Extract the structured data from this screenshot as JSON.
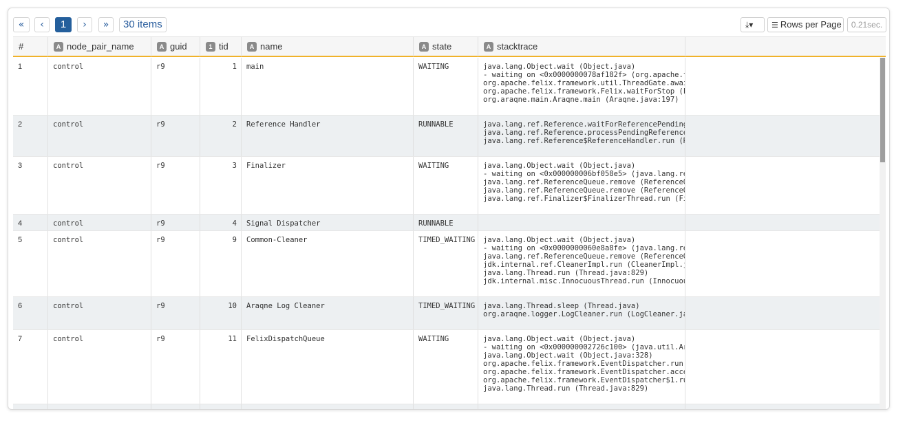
{
  "pagination": {
    "first": "«",
    "prev": "‹",
    "current": "1",
    "next": "›",
    "last": "»",
    "items": "30 items"
  },
  "toolbar": {
    "download_icon": "download-icon",
    "download_glyph": "⤓▾",
    "rows_icon": "list-icon",
    "rows_glyph": "☰",
    "rows_label": "Rows per Page",
    "timing": "0.21sec."
  },
  "columns": [
    {
      "label": "#",
      "badge": ""
    },
    {
      "label": "node_pair_name",
      "badge": "A"
    },
    {
      "label": "guid",
      "badge": "A"
    },
    {
      "label": "tid",
      "badge": "1"
    },
    {
      "label": "name",
      "badge": "A"
    },
    {
      "label": "state",
      "badge": "A"
    },
    {
      "label": "stacktrace",
      "badge": "A"
    }
  ],
  "rows": [
    {
      "n": "1",
      "node": "control",
      "guid": "r9",
      "tid": "1",
      "name": "main",
      "state": "WAITING",
      "stack": "java.lang.Object.wait (Object.java)\n- waiting on <0x0000000078af182f> (org.apache.fel\norg.apache.felix.framework.util.ThreadGate.await\norg.apache.felix.framework.Felix.waitForStop (Fel\norg.araqne.main.Araqne.main (Araqne.java:197)"
    },
    {
      "n": "2",
      "node": "control",
      "guid": "r9",
      "tid": "2",
      "name": "Reference Handler",
      "state": "RUNNABLE",
      "stack": "java.lang.ref.Reference.waitForReferencePendingLi\njava.lang.ref.Reference.processPendingReferences\njava.lang.ref.Reference$ReferenceHandler.run (Ref"
    },
    {
      "n": "3",
      "node": "control",
      "guid": "r9",
      "tid": "3",
      "name": "Finalizer",
      "state": "WAITING",
      "stack": "java.lang.Object.wait (Object.java)\n- waiting on <0x000000006bf058e5> (java.lang.ref.\njava.lang.ref.ReferenceQueue.remove (ReferenceQue\njava.lang.ref.ReferenceQueue.remove (ReferenceQue\njava.lang.ref.Finalizer$FinalizerThread.run (Fina"
    },
    {
      "n": "4",
      "node": "control",
      "guid": "r9",
      "tid": "4",
      "name": "Signal Dispatcher",
      "state": "RUNNABLE",
      "stack": ""
    },
    {
      "n": "5",
      "node": "control",
      "guid": "r9",
      "tid": "9",
      "name": "Common-Cleaner",
      "state": "TIMED_WAITING",
      "stack": "java.lang.Object.wait (Object.java)\n- waiting on <0x0000000060e8a8fe> (java.lang.ref.\njava.lang.ref.ReferenceQueue.remove (ReferenceQue\njdk.internal.ref.CleanerImpl.run (CleanerImpl.jav\njava.lang.Thread.run (Thread.java:829)\njdk.internal.misc.InnocuousThread.run (InnocuousT"
    },
    {
      "n": "6",
      "node": "control",
      "guid": "r9",
      "tid": "10",
      "name": "Araqne Log Cleaner",
      "state": "TIMED_WAITING",
      "stack": "java.lang.Thread.sleep (Thread.java)\norg.araqne.logger.LogCleaner.run (LogCleaner.java"
    },
    {
      "n": "7",
      "node": "control",
      "guid": "r9",
      "tid": "11",
      "name": "FelixDispatchQueue",
      "state": "WAITING",
      "stack": "java.lang.Object.wait (Object.java)\n- waiting on <0x000000002726c100> (java.util.Arra\njava.lang.Object.wait (Object.java:328)\norg.apache.felix.framework.EventDispatcher.run (E\norg.apache.felix.framework.EventDispatcher.access\norg.apache.felix.framework.EventDispatcher$1.run\njava.lang.Thread.run (Thread.java:829)"
    }
  ]
}
